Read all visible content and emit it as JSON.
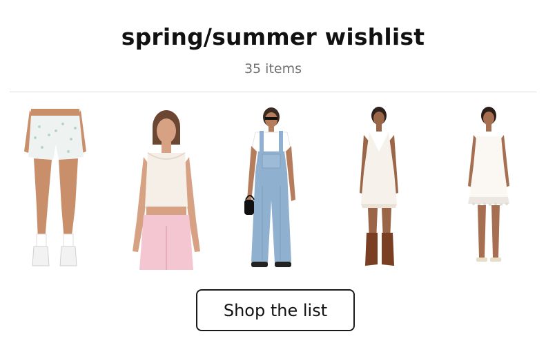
{
  "wishlist": {
    "title": "spring/summer wishlist",
    "item_count": "35 items",
    "cta_label": "Shop the list"
  },
  "products": [
    {
      "name": "product-image-lace-shorts"
    },
    {
      "name": "product-image-tank-pink-pants"
    },
    {
      "name": "product-image-denim-overalls"
    },
    {
      "name": "product-image-white-halter-dress"
    },
    {
      "name": "product-image-white-lace-slip-dress"
    }
  ],
  "colors": {
    "text": "#111111",
    "muted": "#6f6f6f",
    "divider": "#dcdcdc",
    "skin": "#c98f6a",
    "denim": "#8fb0cf",
    "pink": "#f3c6d2",
    "cream": "#f6f1ea"
  }
}
